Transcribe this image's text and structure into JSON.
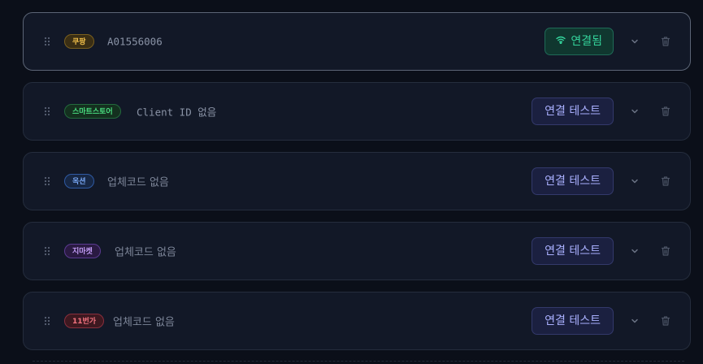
{
  "marketplaces": [
    {
      "badge": "쿠팡",
      "identifier": "A01556006",
      "button_label": "연결됨",
      "status": "connected",
      "badge_color": "#f2c04a"
    },
    {
      "badge": "스마트스토어",
      "identifier": "Client ID 없음",
      "button_label": "연결 테스트",
      "status": "untested",
      "badge_color": "#4ade80"
    },
    {
      "badge": "옥션",
      "identifier": "업체코드 없음",
      "button_label": "연결 테스트",
      "status": "untested",
      "badge_color": "#79a8f5"
    },
    {
      "badge": "지마켓",
      "identifier": "업체코드 없음",
      "button_label": "연결 테스트",
      "status": "untested",
      "badge_color": "#c29cf5"
    },
    {
      "badge": "11번가",
      "identifier": "업체코드 없음",
      "button_label": "연결 테스트",
      "status": "untested",
      "badge_color": "#f47480"
    }
  ],
  "icons": {
    "drag": "drag-handle-icon",
    "connected": "wifi-icon",
    "expand": "chevron-down-icon",
    "delete": "trash-icon"
  },
  "colors": {
    "background": "#0b0f19",
    "card": "#121827",
    "connected_accent": "#34d39b",
    "test_accent": "#aab0ff"
  }
}
